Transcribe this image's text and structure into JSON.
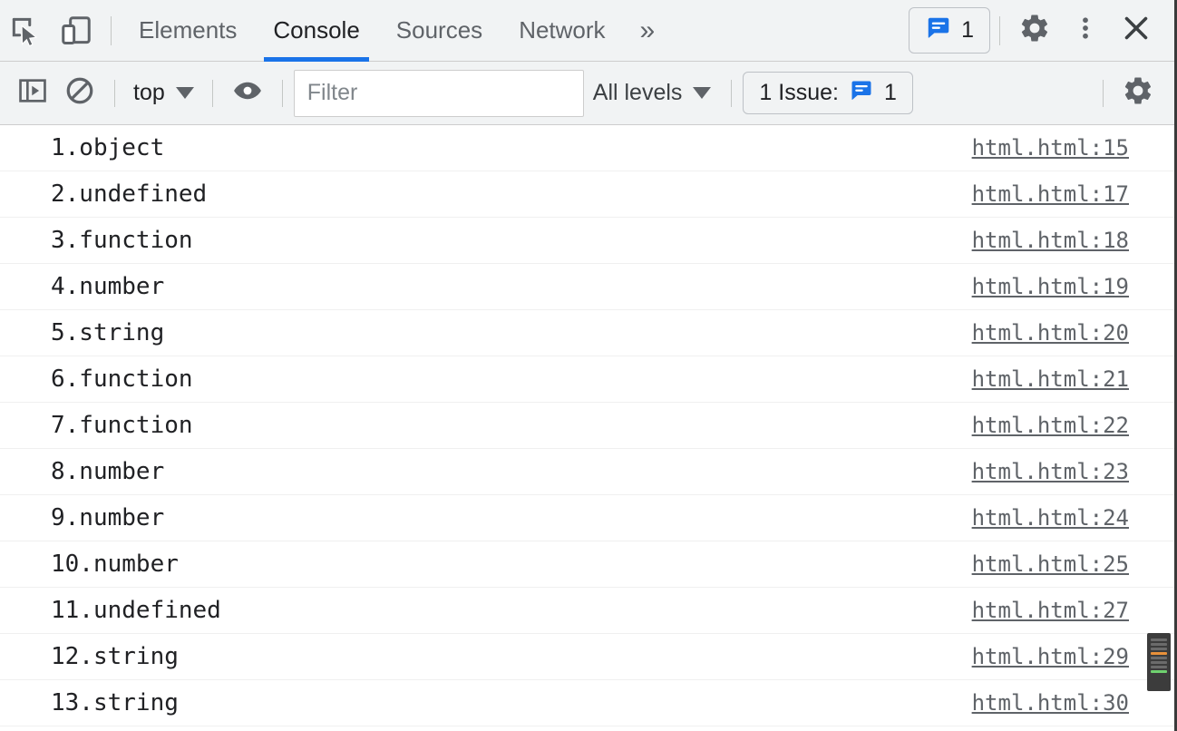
{
  "tabbar": {
    "inspect_icon": "inspect-element-icon",
    "device_icon": "device-toolbar-icon",
    "tabs": [
      {
        "label": "Elements",
        "active": false
      },
      {
        "label": "Console",
        "active": true
      },
      {
        "label": "Sources",
        "active": false
      },
      {
        "label": "Network",
        "active": false
      }
    ],
    "more_tabs_label": "»",
    "issues_badge": {
      "icon": "issues-message-icon",
      "count": "1"
    },
    "settings_icon": "gear-icon",
    "more_options_icon": "kebab-menu-icon",
    "close_icon": "close-icon"
  },
  "filterbar": {
    "sidebar_toggle_icon": "console-sidebar-icon",
    "clear_console_icon": "clear-console-icon",
    "context_selector": {
      "value": "top",
      "caret": "chevron-down-icon"
    },
    "live_expression_icon": "eye-icon",
    "filter": {
      "value": "",
      "placeholder": "Filter"
    },
    "levels_selector": {
      "value": "All levels",
      "caret": "chevron-down-icon"
    },
    "issue_counter": {
      "label": "1 Issue:",
      "icon": "issues-message-icon",
      "count": "1"
    },
    "settings_icon": "gear-icon"
  },
  "console": {
    "rows": [
      {
        "message": "1.object",
        "source": "html.html:15"
      },
      {
        "message": "2.undefined",
        "source": "html.html:17"
      },
      {
        "message": "3.function",
        "source": "html.html:18"
      },
      {
        "message": "4.number",
        "source": "html.html:19"
      },
      {
        "message": "5.string",
        "source": "html.html:20"
      },
      {
        "message": "6.function",
        "source": "html.html:21"
      },
      {
        "message": "7.function",
        "source": "html.html:22"
      },
      {
        "message": "8.number",
        "source": "html.html:23"
      },
      {
        "message": "9.number",
        "source": "html.html:24"
      },
      {
        "message": "10.number",
        "source": "html.html:25"
      },
      {
        "message": "11.undefined",
        "source": "html.html:27"
      },
      {
        "message": "12.string",
        "source": "html.html:29"
      },
      {
        "message": "13.string",
        "source": "html.html:30"
      }
    ]
  },
  "colors": {
    "accent_blue": "#1a73e8",
    "toolbar_bg": "#f1f3f4",
    "text_primary": "#202124",
    "text_secondary": "#5f6368",
    "row_divider": "#f0f0f0"
  }
}
